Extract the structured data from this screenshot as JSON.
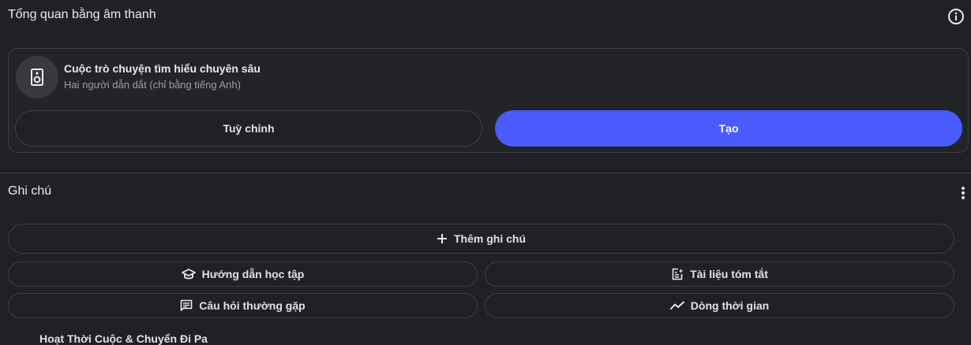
{
  "audio_overview": {
    "title": "Tổng quan bằng âm thanh",
    "card": {
      "title": "Cuộc trò chuyện tìm hiểu chuyên sâu",
      "subtitle": "Hai người dẫn dắt (chỉ bằng tiếng Anh)"
    },
    "customize_label": "Tuỳ chỉnh",
    "create_label": "Tạo"
  },
  "notes": {
    "title": "Ghi chú",
    "add_note_label": "Thêm ghi chú",
    "study_guide_label": "Hướng dẫn học tập",
    "briefing_doc_label": "Tài liệu tóm tắt",
    "faq_label": "Câu hỏi thường gặp",
    "timeline_label": "Dòng thời gian",
    "cutoff_note_title": "Hoạt Thời Cuộc & Chuyển Đi Pa"
  },
  "colors": {
    "background": "#202124",
    "accent": "#4a5bfc",
    "border": "#3c4043"
  },
  "icons": {
    "info": "info-icon",
    "speaker": "speaker-icon",
    "more": "more-vert-icon",
    "add": "plus-icon",
    "study": "graduation-cap-icon",
    "briefing": "document-sparkle-icon",
    "faq": "chat-lines-icon",
    "timeline": "trend-line-icon"
  }
}
